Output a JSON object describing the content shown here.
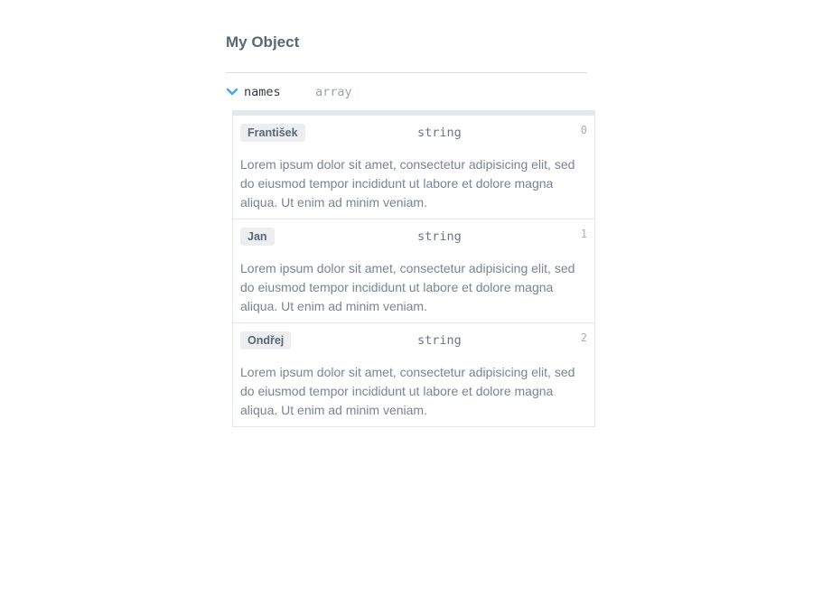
{
  "object": {
    "title": "My Object"
  },
  "property": {
    "name": "names",
    "type": "array",
    "icon": "chevron-down-icon",
    "accent_color": "#3fa9e8"
  },
  "items": [
    {
      "tag": "František",
      "type": "string",
      "index": "0",
      "description": "Lorem ipsum dolor sit amet, consectetur adipisicing elit, sed do eiusmod tempor incididunt ut labore et dolore magna aliqua. Ut enim ad minim veniam."
    },
    {
      "tag": "Jan",
      "type": "string",
      "index": "1",
      "description": "Lorem ipsum dolor sit amet, consectetur adipisicing elit, sed do eiusmod tempor incididunt ut labore et dolore magna aliqua. Ut enim ad minim veniam."
    },
    {
      "tag": "Ondřej",
      "type": "string",
      "index": "2",
      "description": "Lorem ipsum dolor sit amet, consectetur adipisicing elit, sed do eiusmod tempor incididunt ut labore et dolore magna aliqua. Ut enim ad minim veniam."
    }
  ]
}
